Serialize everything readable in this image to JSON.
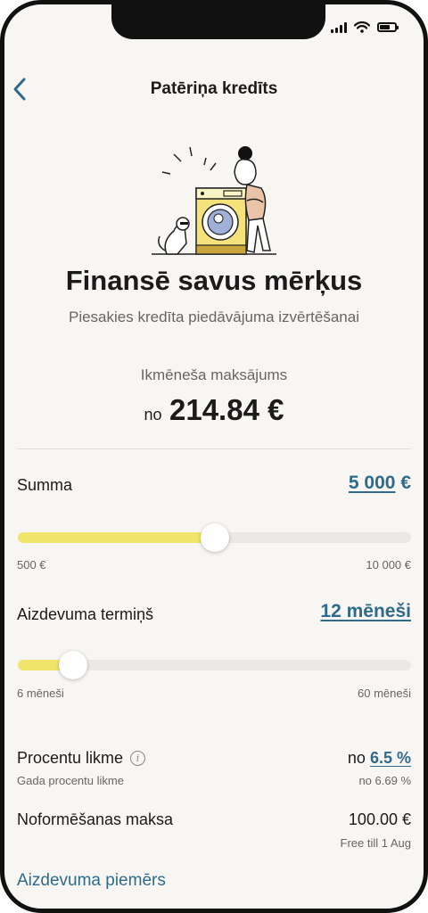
{
  "header": {
    "title": "Patēriņa kredīts"
  },
  "hero": {
    "title": "Finansē savus mērķus",
    "subtitle": "Piesakies kredīta piedāvājuma izvērtēšanai"
  },
  "monthly_payment": {
    "label": "Ikmēneša maksājums",
    "prefix": "no",
    "value": "214.84 €"
  },
  "amount": {
    "label": "Summa",
    "value": "5 000",
    "currency": "€",
    "min": "500 €",
    "max": "10 000 €",
    "slider_fraction": 0.5
  },
  "term": {
    "label": "Aizdevuma termiņš",
    "value": "12 mēneši",
    "min": "6 mēneši",
    "max": "60 mēneši",
    "slider_fraction": 0.14
  },
  "interest": {
    "label": "Procentu likme",
    "sublabel": "Gada procentu likme",
    "prefix": "no",
    "value": "6.5 %",
    "sub_value": "no 6.69 %"
  },
  "fee": {
    "label": "Noformēšanas maksa",
    "value": "100.00 €",
    "note": "Free till 1 Aug"
  },
  "example_link": "Aizdevuma piemērs",
  "colors": {
    "accent": "#2f6a8c",
    "slider_fill": "#f0e56a",
    "track": "#ebe9e5",
    "background": "#f8f6f3"
  },
  "icons": [
    "back-icon",
    "info-icon",
    "signal-icon",
    "wifi-icon",
    "battery-icon"
  ]
}
